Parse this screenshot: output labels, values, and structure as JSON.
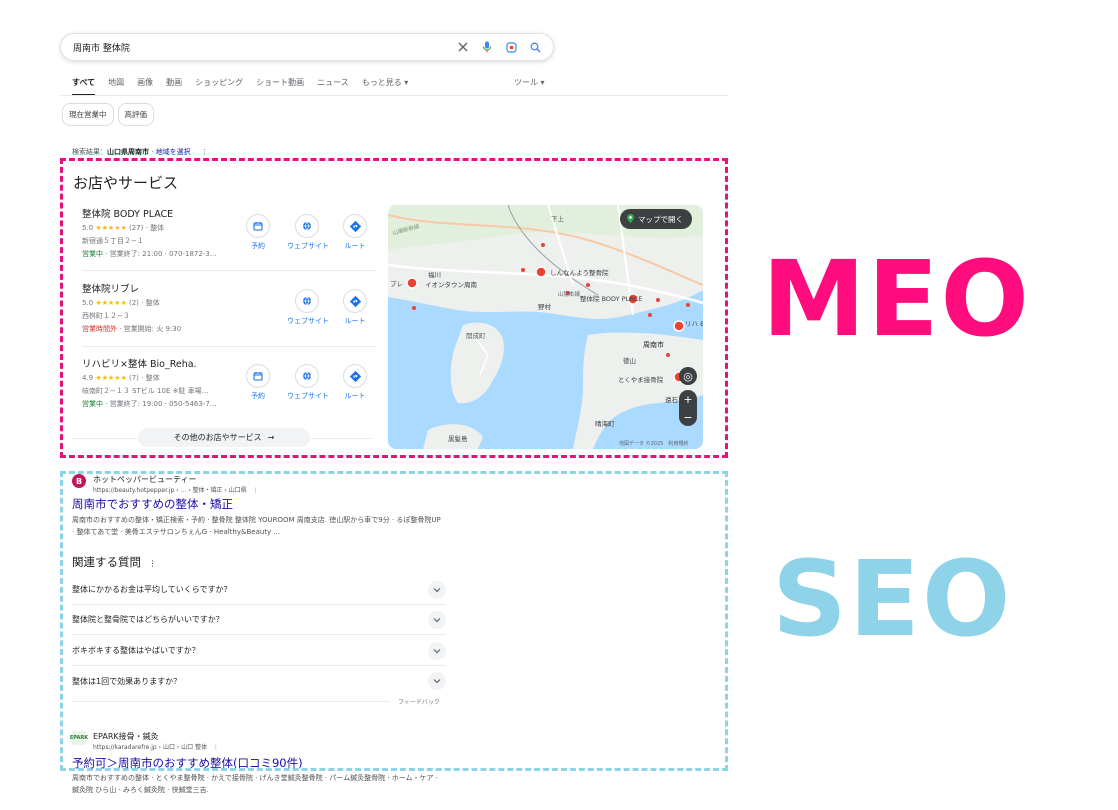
{
  "search": {
    "query": "周南市 整体院"
  },
  "tabs": [
    "すべて",
    "地図",
    "画像",
    "動画",
    "ショッピング",
    "ショート動画",
    "ニュース",
    "もっと見る ▾"
  ],
  "tools_label": "ツール ▾",
  "chips": [
    "現在営業中",
    "高評価"
  ],
  "location": {
    "prefix": "検索結果：",
    "place": "山口県周南市",
    "sep": " · ",
    "link": "地域を選択"
  },
  "local": {
    "title": "お店やサービス",
    "businesses": [
      {
        "name": "整体院 BODY PLACE",
        "rating": "5.0",
        "stars": "★★★★★",
        "count": "(27)",
        "category": "整体",
        "address": "新宿通５丁目２−１",
        "status": "営業中",
        "status_rest": " · 営業終了: 21:00 · 070-1872-3...",
        "open": true
      },
      {
        "name": "整体院リブレ",
        "rating": "5.0",
        "stars": "★★★★★",
        "count": "(2)",
        "category": "整体",
        "address": "西桝町１２−３",
        "status": "営業時間外",
        "status_rest": " · 営業開始: 火 9:30",
        "open": false
      },
      {
        "name": "リハビリ×整体 Bio_Reha.",
        "rating": "4.9",
        "stars": "★★★★★",
        "count": "(7)",
        "category": "整体",
        "address": "岐南町２−１３ STビル 10E ※駐 車場...",
        "status": "営業中",
        "status_rest": " · 営業終了: 19:00 · 050-5463-7...",
        "open": true
      }
    ],
    "actions": {
      "reserve": "予約",
      "website": "ウェブサイト",
      "route": "ルート"
    },
    "more_label": "その他のお店やサービス"
  },
  "map": {
    "open_label": "マップで開く",
    "attribution": "地図データ ©2025　利用規約",
    "labels": [
      "下上",
      "福川",
      "イオンタウン周南",
      "しんなんよう整骨院",
      "野村",
      "整体院 BODY PLACE",
      "開成町",
      "周南市",
      "徳山",
      "とくやま接骨院",
      "遠石",
      "晴海町",
      "黒髪島",
      "リハ Bio",
      "プレ",
      "山陽新幹線",
      "山陽本線"
    ]
  },
  "results": [
    {
      "site": "ホットペッパービューティー",
      "url": "https://beauty.hotpepper.jp › ... › 整体・矯正 › 山口県",
      "title": "周南市でおすすめの整体・矯正",
      "snippet": "周南市のおすすめの整体・矯正検索・予約 · 整骨院 整体院 YOUROOM 周南支店. 徳山駅から車で9分 · るぽ整骨院UP · 整体てあて堂 · 美骨エステサロンちぇんG · Healthy&Beauty ..."
    },
    {
      "site": "EPARK接骨・鍼灸",
      "url": "https://karadarefre.jp › 山口 › 山口 整体",
      "title": "予約可＞周南市のおすすめ整体(口コミ90件)",
      "snippet": "周南市でおすすめの整体 · とくやま整骨院 · かえで接骨院 · げんき堂鍼灸整骨院 · パーム鍼灸整骨院 · ホーム・ケア · 鍼灸院 ひら山 · みろく鍼灸院 · 快鍼堂三吉."
    }
  ],
  "paa": {
    "title": "関連する質問",
    "questions": [
      "整体にかかるお金は平均していくらですか？",
      "整体院と整骨院ではどちらがいいですか？",
      "ボキボキする整体はやばいですか？",
      "整体は1回で効果ありますか？"
    ],
    "feedback": "フィードバック"
  },
  "labels": {
    "meo": "MEO",
    "seo": "SEO"
  },
  "colors": {
    "meo": "#ff0c7e",
    "seo": "#8fd3e8",
    "link": "#1a0dab",
    "open": "#188038",
    "closed": "#d93025"
  }
}
